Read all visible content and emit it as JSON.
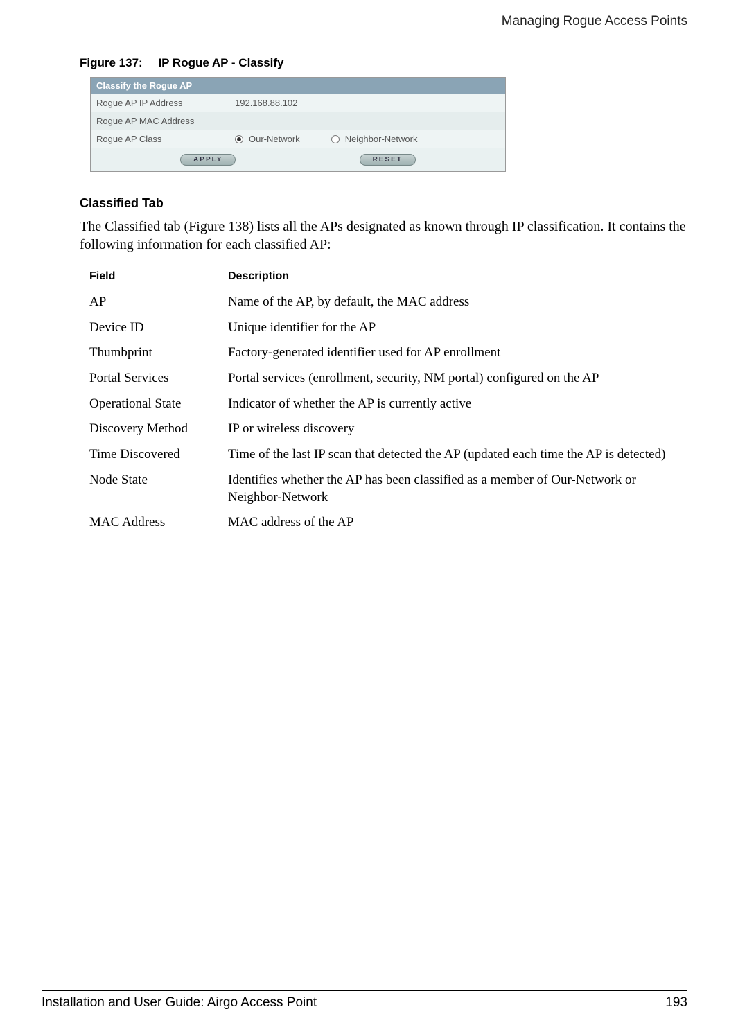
{
  "header": {
    "title": "Managing Rogue Access Points"
  },
  "figure": {
    "number": "Figure 137:",
    "title": "IP Rogue AP - Classify"
  },
  "screenshot": {
    "title": "Classify the Rogue AP",
    "rows": [
      {
        "label": "Rogue AP IP Address",
        "value": "192.168.88.102"
      },
      {
        "label": "Rogue AP MAC Address",
        "value": ""
      },
      {
        "label": "Rogue AP Class"
      }
    ],
    "radio": {
      "opt1": "Our-Network",
      "opt2": "Neighbor-Network"
    },
    "buttons": {
      "apply": "Apply",
      "reset": "Reset"
    }
  },
  "section": {
    "heading": "Classified Tab"
  },
  "paragraph": "The Classified tab (Figure 138) lists all the APs designated as known through IP classification. It contains the following information for each classified AP:",
  "table": {
    "headers": {
      "field": "Field",
      "desc": "Description"
    },
    "rows": [
      {
        "field": "AP",
        "desc": "Name of the AP, by default, the MAC address"
      },
      {
        "field": "Device ID",
        "desc": "Unique identifier for the AP"
      },
      {
        "field": "Thumbprint",
        "desc": "Factory-generated identifier used for AP enrollment"
      },
      {
        "field": "Portal Services",
        "desc": "Portal services (enrollment, security, NM portal) configured on the AP"
      },
      {
        "field": "Operational State",
        "desc": "Indicator of whether the AP is currently active"
      },
      {
        "field": "Discovery Method",
        "desc": "IP or wireless discovery"
      },
      {
        "field": "Time Discovered",
        "desc": "Time of the last IP scan that detected the AP (updated each time the AP is detected)"
      },
      {
        "field": "Node State",
        "desc": "Identifies whether the AP has been classified as a member of Our-Network or Neighbor-Network"
      },
      {
        "field": "MAC Address",
        "desc": "MAC address of the AP"
      }
    ]
  },
  "footer": {
    "left": "Installation and User Guide: Airgo Access Point",
    "right": "193"
  }
}
